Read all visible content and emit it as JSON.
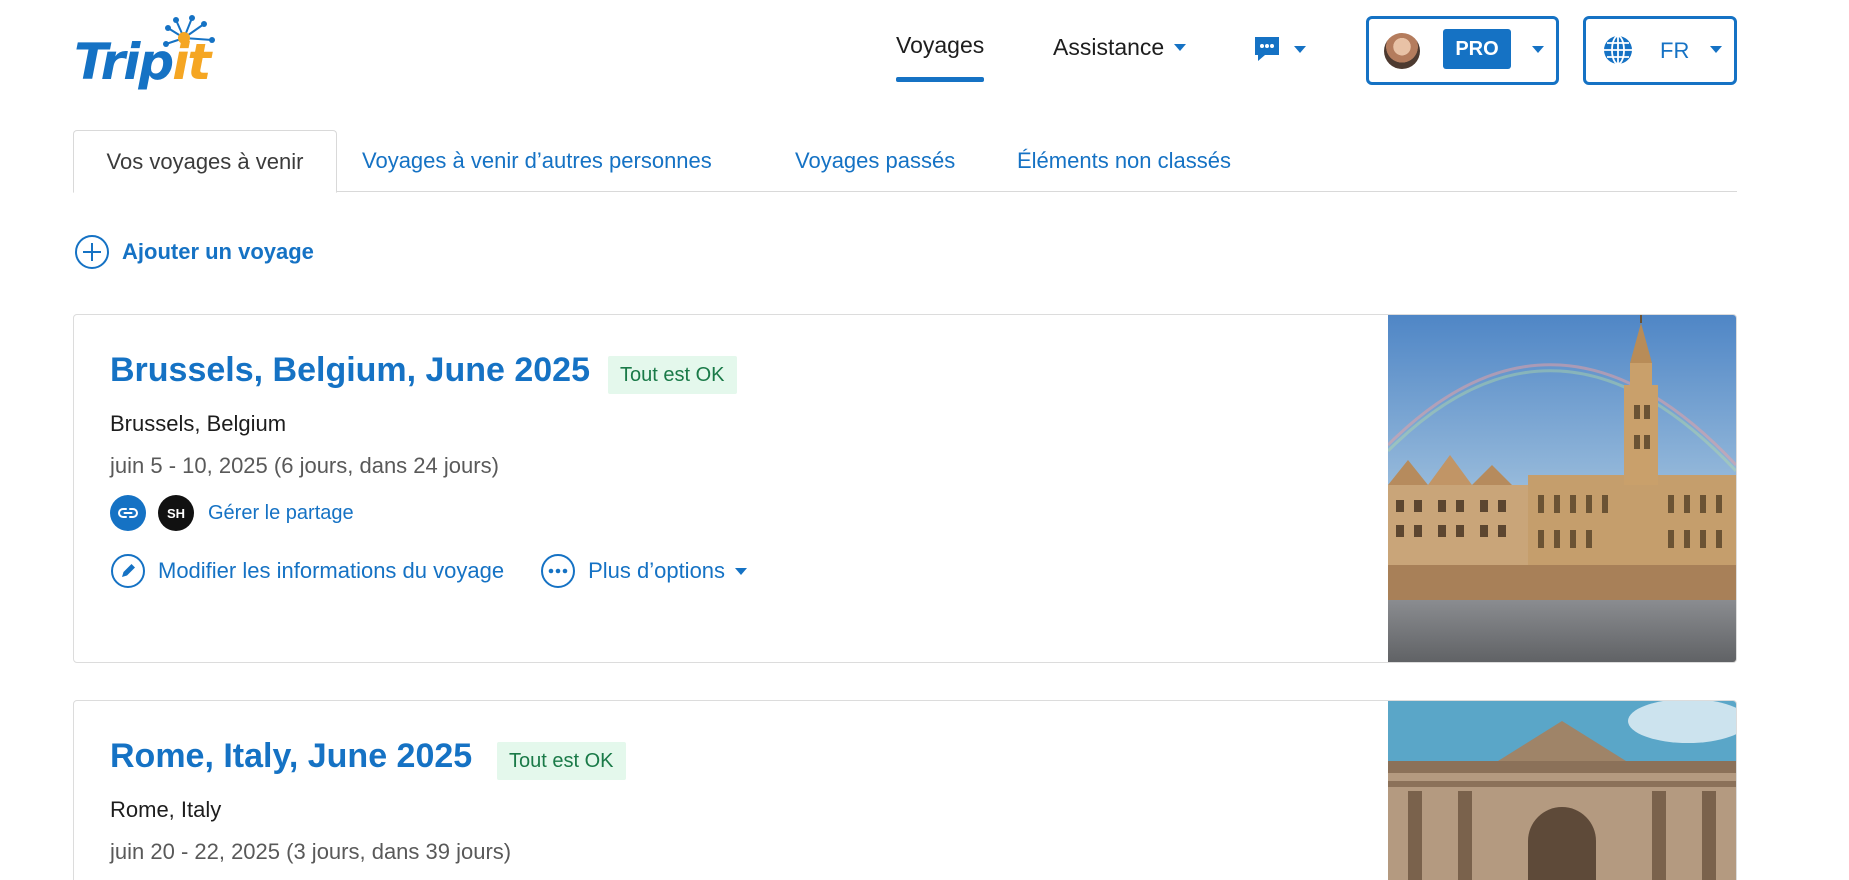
{
  "header": {
    "logo": "TripIt",
    "nav_voyages": "Voyages",
    "nav_assistance": "Assistance",
    "badge_pro": "PRO",
    "language": "FR"
  },
  "tabs": [
    {
      "label": "Vos voyages à venir",
      "active": true
    },
    {
      "label": "Voyages à venir d’autres personnes",
      "active": false
    },
    {
      "label": "Voyages passés",
      "active": false
    },
    {
      "label": "Éléments non classés",
      "active": false
    }
  ],
  "add_trip_label": "Ajouter un voyage",
  "trips": [
    {
      "title": "Brussels, Belgium, June 2025",
      "status": "Tout est OK",
      "place": "Brussels, Belgium",
      "dates": "juin 5 - 10, 2025 (6 jours, dans 24 jours)",
      "share_initials": "SH",
      "manage_share": "Gérer le partage",
      "edit_label": "Modifier les informations du voyage",
      "more_label": "Plus d’options"
    },
    {
      "title": "Rome, Italy, June 2025",
      "status": "Tout est OK",
      "place": "Rome, Italy",
      "dates": "juin 20 - 22, 2025 (3 jours, dans 39 jours)"
    }
  ],
  "colors": {
    "accent": "#1572c4",
    "logo_orange": "#f5a623",
    "status_bg": "#e4f8ec",
    "status_text": "#1a7a48"
  },
  "icons": [
    "chat-icon",
    "globe-icon",
    "plus-circle-icon",
    "link-icon",
    "pencil-icon",
    "more-dots-icon",
    "chevron-down-icon"
  ]
}
